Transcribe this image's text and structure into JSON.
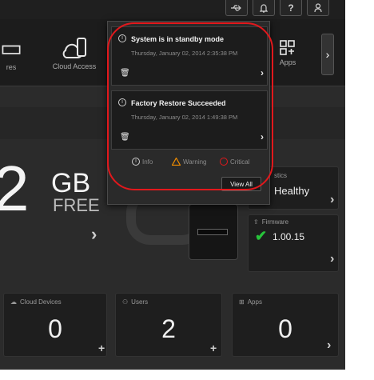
{
  "topbar": {
    "usb_icon": "usb-icon",
    "bell_icon": "bell-icon",
    "help_label": "?",
    "user_icon": "user-icon"
  },
  "nav": {
    "items": [
      {
        "label": "res",
        "icon": "shares-icon"
      },
      {
        "label": "Cloud Access",
        "icon": "cloud-access-icon"
      },
      {
        "label": "Apps",
        "icon": "apps-icon"
      }
    ],
    "next_arrow": "›"
  },
  "capacity": {
    "number": "2",
    "unit": "GB",
    "free_label": "FREE",
    "arrow": "›"
  },
  "diagnostics": {
    "title": "stics",
    "status": "Healthy",
    "arrow": "›"
  },
  "firmware": {
    "title": "Firmware",
    "version": "1.00.15",
    "check": "✔",
    "arrow": "›"
  },
  "bottom_tiles": [
    {
      "title": "Cloud Devices",
      "value": "0",
      "action": "+"
    },
    {
      "title": "Users",
      "value": "2",
      "action": "+"
    },
    {
      "title": "Apps",
      "value": "0",
      "action": "›"
    }
  ],
  "popup": {
    "notifications": [
      {
        "title": "System is in standby mode",
        "time": "Thursday, January 02, 2014 2:35:38 PM"
      },
      {
        "title": "Factory Restore Succeeded",
        "time": "Thursday, January 02, 2014 1:49:38 PM"
      }
    ],
    "legend": {
      "info": "Info",
      "warning": "Warning",
      "critical": "Critical"
    },
    "view_all": "View All"
  },
  "colors": {
    "background": "#2b2b2b",
    "accent_red": "#e2181c",
    "warning": "#f08c00",
    "healthy_check": "#27c43a"
  }
}
